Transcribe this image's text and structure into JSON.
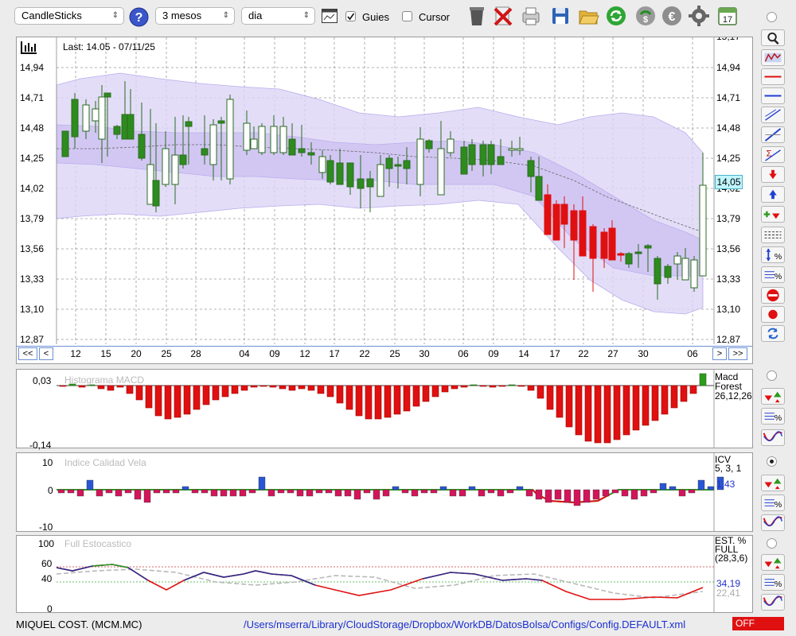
{
  "toolbar": {
    "symbol_select": "CandleSticks",
    "period_select": "3 mesos",
    "interval_select": "dia",
    "guides_label": "Guies",
    "guides_checked": true,
    "cursor_label": "Cursor",
    "cursor_checked": false,
    "icons": [
      "help-icon",
      "chart-icon",
      "trash-icon",
      "delete-icon",
      "print-icon",
      "save-icon",
      "open-folder-icon",
      "refresh-icon",
      "update-icon",
      "euro-icon",
      "gear-icon",
      "calendar-icon"
    ],
    "calendar_day": "17"
  },
  "main_chart": {
    "info": "Last: 14.05 - 07/11/25",
    "last_price_tag": "14,05",
    "y_labels": [
      "14,94",
      "14,71",
      "14,48",
      "14,25",
      "14,02",
      "13,79",
      "13,56",
      "13,33",
      "13,10",
      "12,87"
    ],
    "y_top_partial": "15,17",
    "x_labels": [
      "12",
      "15",
      "20",
      "25",
      "28",
      "04",
      "09",
      "12",
      "17",
      "22",
      "25",
      "30",
      "06",
      "09",
      "14",
      "17",
      "22",
      "27",
      "30",
      "06"
    ],
    "nav_left": [
      "<<",
      "<"
    ],
    "nav_right": [
      ">",
      ">>"
    ],
    "colors": {
      "up": "#2e8b1e",
      "down": "#e01010",
      "band": "#d8d0f4",
      "grid": "#888888"
    }
  },
  "macd_panel": {
    "title": "Histograma MACD",
    "y_labels": [
      "0,03",
      "-0,14"
    ],
    "legend": [
      "Macd",
      "Forest",
      "26,12,26"
    ]
  },
  "icv_panel": {
    "title": "Indice Calidad Vela",
    "y_labels": [
      "10",
      "0",
      "-10"
    ],
    "legend": [
      "ICV",
      "5, 3, 1"
    ],
    "value": "1,43"
  },
  "stoch_panel": {
    "title": "Full Estocastico",
    "y_labels": [
      "100",
      "60",
      "40",
      "0"
    ],
    "legend": [
      "EST. %",
      "FULL",
      "(28,3,6)"
    ],
    "value1": "34,19",
    "value2": "22,41"
  },
  "status": {
    "company": "MIQUEL COST. (MCM.MC)",
    "path": "/Users/mserra/Library/CloudStorage/Dropbox/WorkDB/DatosBolsa/Configs/Config.DEFAULT.xml",
    "off_label": "OFF"
  }
}
